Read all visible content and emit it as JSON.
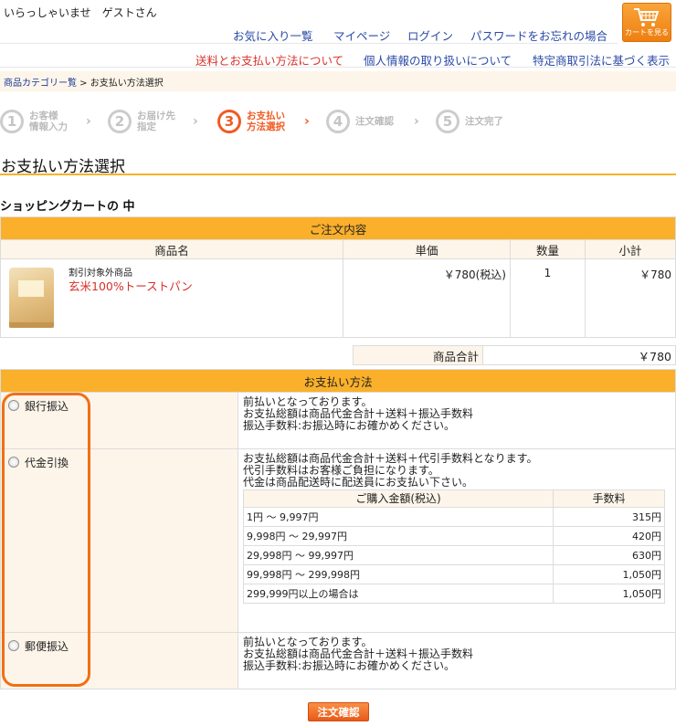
{
  "header": {
    "greeting": "いらっしゃいませ　ゲストさん",
    "cart_button_label": "カートを見る",
    "nav_primary": [
      "お気に入り一覧",
      "マイページ",
      "ログイン",
      "パスワードをお忘れの場合"
    ],
    "nav_secondary": [
      "送料とお支払い方法について",
      "個人情報の取り扱いについて",
      "特定商取引法に基づく表示"
    ]
  },
  "breadcrumb": {
    "link": "商品カテゴリー覧",
    "separator": " > ",
    "current": "お支払い方法選択"
  },
  "steps": [
    {
      "number": "1",
      "label": "お客様\n情報入力"
    },
    {
      "number": "2",
      "label": "お届け先\n指定"
    },
    {
      "number": "3",
      "label": "お支払い\n方法選択"
    },
    {
      "number": "4",
      "label": "注文確認"
    },
    {
      "number": "5",
      "label": "注文完了"
    }
  ],
  "active_step": 3,
  "page_title": "お支払い方法選択",
  "cart_heading": "ショッピングカートの 中",
  "order": {
    "band": "ご注文内容",
    "columns": [
      "商品名",
      "単価",
      "数量",
      "小計"
    ],
    "item": {
      "category": "割引対象外商品",
      "name": "玄米100%トーストパン",
      "price": "￥780(税込)",
      "qty": "1",
      "subtotal": "￥780"
    },
    "total_label": "商品合計",
    "total_value": "￥780"
  },
  "payment": {
    "band": "お支払い方法",
    "methods": [
      {
        "label": "銀行振込",
        "lines": [
          "前払いとなっております。",
          "お支払総額は商品代金合計＋送料＋振込手数料",
          "振込手数料:お振込時にお確かめください。"
        ]
      },
      {
        "label": "代金引換",
        "lines": [
          "お支払総額は商品代金合計＋送料＋代引手数料となります。",
          "代引手数料はお客様ご負担になります。",
          "代金は商品配送時に配送員にお支払い下さい。"
        ]
      },
      {
        "label": "郵便振込",
        "lines": [
          "前払いとなっております。",
          "お支払総額は商品代金合計＋送料＋振込手数料",
          "振込手数料:お振込時にお確かめください。"
        ]
      }
    ],
    "fee_table": {
      "headers": [
        "ご購入金額(税込)",
        "手数料"
      ],
      "rows": [
        [
          "1円 ～ 9,997円",
          "315円"
        ],
        [
          "9,998円 ～ 29,997円",
          "420円"
        ],
        [
          "29,998円 ～ 99,997円",
          "630円"
        ],
        [
          "99,998円 ～ 299,998円",
          "1,050円"
        ],
        [
          "299,999円以上の場合は",
          "1,050円"
        ]
      ]
    }
  },
  "confirm_button": "注文確認",
  "accent_color": "#f15a22",
  "band_color": "#fab02a"
}
